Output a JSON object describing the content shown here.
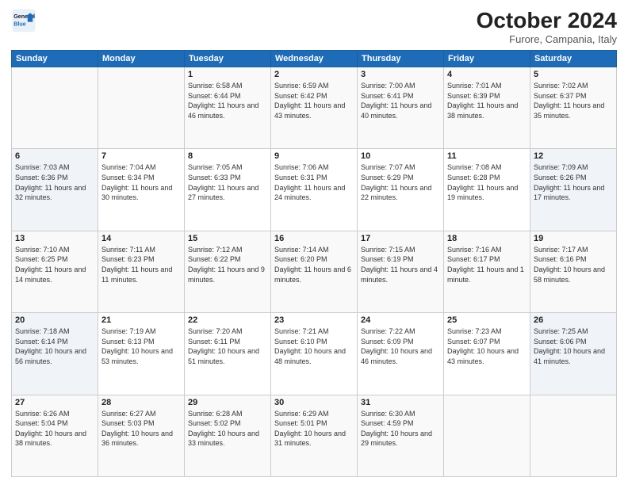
{
  "header": {
    "logo_line1": "General",
    "logo_line2": "Blue",
    "month_title": "October 2024",
    "location": "Furore, Campania, Italy"
  },
  "weekdays": [
    "Sunday",
    "Monday",
    "Tuesday",
    "Wednesday",
    "Thursday",
    "Friday",
    "Saturday"
  ],
  "weeks": [
    [
      {
        "day": "",
        "info": ""
      },
      {
        "day": "",
        "info": ""
      },
      {
        "day": "1",
        "info": "Sunrise: 6:58 AM\nSunset: 6:44 PM\nDaylight: 11 hours and 46 minutes."
      },
      {
        "day": "2",
        "info": "Sunrise: 6:59 AM\nSunset: 6:42 PM\nDaylight: 11 hours and 43 minutes."
      },
      {
        "day": "3",
        "info": "Sunrise: 7:00 AM\nSunset: 6:41 PM\nDaylight: 11 hours and 40 minutes."
      },
      {
        "day": "4",
        "info": "Sunrise: 7:01 AM\nSunset: 6:39 PM\nDaylight: 11 hours and 38 minutes."
      },
      {
        "day": "5",
        "info": "Sunrise: 7:02 AM\nSunset: 6:37 PM\nDaylight: 11 hours and 35 minutes."
      }
    ],
    [
      {
        "day": "6",
        "info": "Sunrise: 7:03 AM\nSunset: 6:36 PM\nDaylight: 11 hours and 32 minutes."
      },
      {
        "day": "7",
        "info": "Sunrise: 7:04 AM\nSunset: 6:34 PM\nDaylight: 11 hours and 30 minutes."
      },
      {
        "day": "8",
        "info": "Sunrise: 7:05 AM\nSunset: 6:33 PM\nDaylight: 11 hours and 27 minutes."
      },
      {
        "day": "9",
        "info": "Sunrise: 7:06 AM\nSunset: 6:31 PM\nDaylight: 11 hours and 24 minutes."
      },
      {
        "day": "10",
        "info": "Sunrise: 7:07 AM\nSunset: 6:29 PM\nDaylight: 11 hours and 22 minutes."
      },
      {
        "day": "11",
        "info": "Sunrise: 7:08 AM\nSunset: 6:28 PM\nDaylight: 11 hours and 19 minutes."
      },
      {
        "day": "12",
        "info": "Sunrise: 7:09 AM\nSunset: 6:26 PM\nDaylight: 11 hours and 17 minutes."
      }
    ],
    [
      {
        "day": "13",
        "info": "Sunrise: 7:10 AM\nSunset: 6:25 PM\nDaylight: 11 hours and 14 minutes."
      },
      {
        "day": "14",
        "info": "Sunrise: 7:11 AM\nSunset: 6:23 PM\nDaylight: 11 hours and 11 minutes."
      },
      {
        "day": "15",
        "info": "Sunrise: 7:12 AM\nSunset: 6:22 PM\nDaylight: 11 hours and 9 minutes."
      },
      {
        "day": "16",
        "info": "Sunrise: 7:14 AM\nSunset: 6:20 PM\nDaylight: 11 hours and 6 minutes."
      },
      {
        "day": "17",
        "info": "Sunrise: 7:15 AM\nSunset: 6:19 PM\nDaylight: 11 hours and 4 minutes."
      },
      {
        "day": "18",
        "info": "Sunrise: 7:16 AM\nSunset: 6:17 PM\nDaylight: 11 hours and 1 minute."
      },
      {
        "day": "19",
        "info": "Sunrise: 7:17 AM\nSunset: 6:16 PM\nDaylight: 10 hours and 58 minutes."
      }
    ],
    [
      {
        "day": "20",
        "info": "Sunrise: 7:18 AM\nSunset: 6:14 PM\nDaylight: 10 hours and 56 minutes."
      },
      {
        "day": "21",
        "info": "Sunrise: 7:19 AM\nSunset: 6:13 PM\nDaylight: 10 hours and 53 minutes."
      },
      {
        "day": "22",
        "info": "Sunrise: 7:20 AM\nSunset: 6:11 PM\nDaylight: 10 hours and 51 minutes."
      },
      {
        "day": "23",
        "info": "Sunrise: 7:21 AM\nSunset: 6:10 PM\nDaylight: 10 hours and 48 minutes."
      },
      {
        "day": "24",
        "info": "Sunrise: 7:22 AM\nSunset: 6:09 PM\nDaylight: 10 hours and 46 minutes."
      },
      {
        "day": "25",
        "info": "Sunrise: 7:23 AM\nSunset: 6:07 PM\nDaylight: 10 hours and 43 minutes."
      },
      {
        "day": "26",
        "info": "Sunrise: 7:25 AM\nSunset: 6:06 PM\nDaylight: 10 hours and 41 minutes."
      }
    ],
    [
      {
        "day": "27",
        "info": "Sunrise: 6:26 AM\nSunset: 5:04 PM\nDaylight: 10 hours and 38 minutes."
      },
      {
        "day": "28",
        "info": "Sunrise: 6:27 AM\nSunset: 5:03 PM\nDaylight: 10 hours and 36 minutes."
      },
      {
        "day": "29",
        "info": "Sunrise: 6:28 AM\nSunset: 5:02 PM\nDaylight: 10 hours and 33 minutes."
      },
      {
        "day": "30",
        "info": "Sunrise: 6:29 AM\nSunset: 5:01 PM\nDaylight: 10 hours and 31 minutes."
      },
      {
        "day": "31",
        "info": "Sunrise: 6:30 AM\nSunset: 4:59 PM\nDaylight: 10 hours and 29 minutes."
      },
      {
        "day": "",
        "info": ""
      },
      {
        "day": "",
        "info": ""
      }
    ]
  ]
}
